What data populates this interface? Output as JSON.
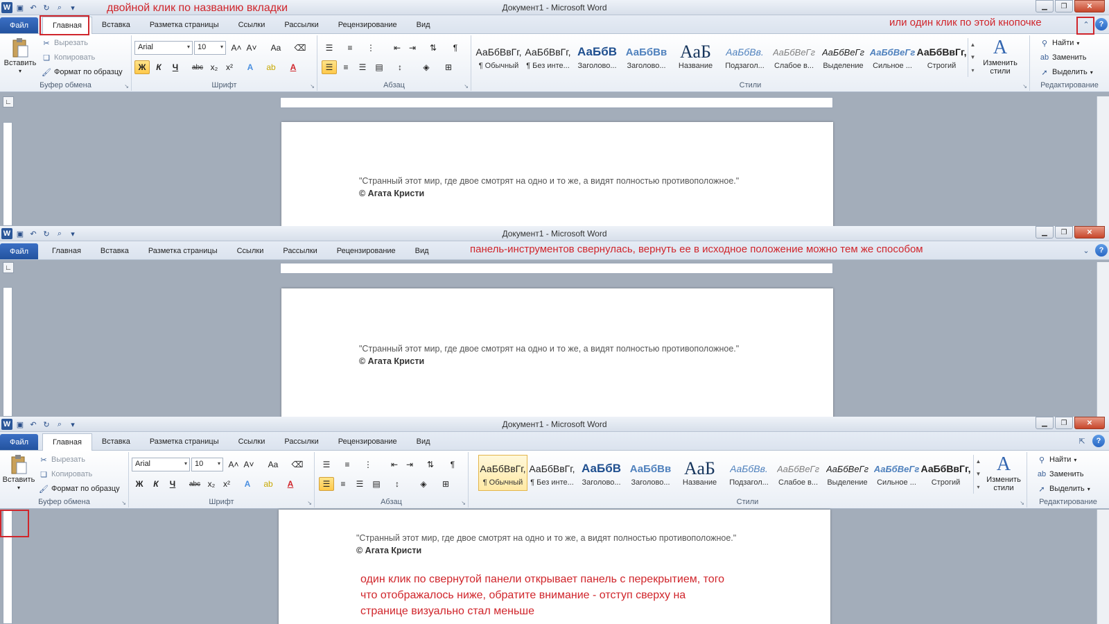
{
  "window": {
    "title": "Документ1 - Microsoft Word"
  },
  "tabs": [
    "Файл",
    "Главная",
    "Вставка",
    "Разметка страницы",
    "Ссылки",
    "Рассылки",
    "Рецензирование",
    "Вид"
  ],
  "ribbon": {
    "clipboard": {
      "label": "Буфер обмена",
      "paste": "Вставить",
      "cut": "Вырезать",
      "copy": "Копировать",
      "format_painter": "Формат по образцу"
    },
    "font": {
      "label": "Шрифт",
      "font_name": "Arial",
      "font_size": "10",
      "bold": "Ж",
      "italic": "К",
      "underline": "Ч",
      "strike": "abc",
      "sub": "x₂",
      "sup": "x²",
      "grow": "A˄",
      "shrink": "A˅",
      "case": "Aa",
      "color_a": "A"
    },
    "paragraph": {
      "label": "Абзац",
      "pilcrow": "¶"
    },
    "styles": {
      "label": "Стили",
      "items": [
        {
          "preview": "АаБбВвГг,",
          "name": "¶ Обычный"
        },
        {
          "preview": "АаБбВвГг,",
          "name": "¶ Без инте..."
        },
        {
          "preview": "АаБбВ",
          "name": "Заголово..."
        },
        {
          "preview": "АаБбВв",
          "name": "Заголово..."
        },
        {
          "preview": "АаБ",
          "name": "Название"
        },
        {
          "preview": "АаБбВв.",
          "name": "Подзагол..."
        },
        {
          "preview": "АаБбВеГг",
          "name": "Слабое в..."
        },
        {
          "preview": "АаБбВеГг",
          "name": "Выделение"
        },
        {
          "preview": "АаБбВеГг",
          "name": "Сильное ..."
        },
        {
          "preview": "АаБбВвГг,",
          "name": "Строгий"
        }
      ],
      "change": "Изменить стили"
    },
    "editing": {
      "label": "Редактирование",
      "find": "Найти",
      "replace": "Заменить",
      "select": "Выделить"
    }
  },
  "document": {
    "quote": "\"Странный  этот мир, где двое смотрят на одно и то же, а видят полностью противоположное.\"",
    "author": "© Агата  Кристи"
  },
  "annotations": {
    "a1": "двойной клик по названию вкладки",
    "a2": "или один клик по этой кнопочке",
    "a3": "панель-инструментов свернулась, вернуть ее в исходное положение можно тем же способом",
    "a4_line1": "один клик по свернутой панели открывает панель с перекрытием, того",
    "a4_line2": "что отображалось ниже, обратите внимание - отступ сверху на",
    "a4_line3": "странице визуально стал меньше"
  },
  "colors": {
    "accent": "#2b579a",
    "annotation": "#d0252b",
    "selected_button": "#ffc94a"
  }
}
